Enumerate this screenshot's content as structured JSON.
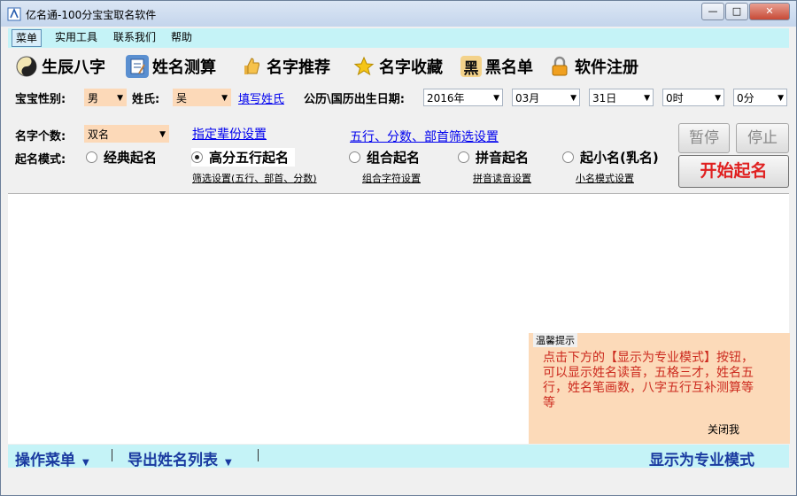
{
  "window": {
    "title": "亿名通-100分宝宝取名软件"
  },
  "menubar": {
    "items": [
      "菜单",
      "实用工具",
      "联系我们",
      "帮助"
    ]
  },
  "toolbar": {
    "buttons": [
      {
        "label": "生辰八字",
        "icon": "bagua-icon"
      },
      {
        "label": "姓名测算",
        "icon": "book-icon"
      },
      {
        "label": "名字推荐",
        "icon": "thumbs-up-icon"
      },
      {
        "label": "名字收藏",
        "icon": "star-icon"
      },
      {
        "label": "黑名单",
        "icon": "blacklist-icon"
      },
      {
        "label": "软件注册",
        "icon": "lock-icon"
      }
    ],
    "blacklist_glyph": "黑"
  },
  "form": {
    "gender_label": "宝宝性别:",
    "gender_value": "男",
    "surname_label": "姓氏:",
    "surname_value": "吴",
    "fill_surname_link": "填写姓氏",
    "birthdate_label": "公历\\国历出生日期:",
    "year_value": "2016年",
    "month_value": "03月",
    "day_value": "31日",
    "hour_value": "0时",
    "minute_value": "0分",
    "name_count_label": "名字个数:",
    "name_count_value": "双名",
    "generation_link": "指定辈份设置",
    "wuxing_link": "五行、分数、部首筛选设置",
    "mode_label": "起名模式:",
    "modes": [
      {
        "label": "经典起名",
        "selected": false,
        "sub": ""
      },
      {
        "label": "高分五行起名",
        "selected": true,
        "sub": "筛选设置(五行、部首、分数)"
      },
      {
        "label": "组合起名",
        "selected": false,
        "sub": "组合字符设置"
      },
      {
        "label": "拼音起名",
        "selected": false,
        "sub": "拼音读音设置"
      },
      {
        "label": "起小名(乳名)",
        "selected": false,
        "sub": "小名模式设置"
      }
    ]
  },
  "buttons": {
    "pause": "暂停",
    "stop": "停止",
    "start": "开始起名"
  },
  "tip": {
    "title": "温馨提示",
    "text": "点击下方的【显示为专业模式】按钮，可以显示姓名读音，五格三才，姓名五行，姓名笔画数，八字五行互补测算等等",
    "close": "关闭我"
  },
  "bottombar": {
    "menu": "操作菜单",
    "export": "导出姓名列表",
    "pro_mode": "显示为专业模式"
  },
  "colors": {
    "accent_bg": "#c5f3f7",
    "peach": "#fcd9b8",
    "start_red": "#e02020",
    "link_blue": "#0000ee"
  }
}
